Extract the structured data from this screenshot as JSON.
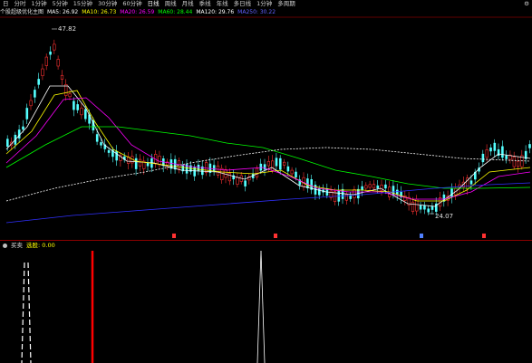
{
  "colors": {
    "bg": "#000000",
    "up_candle": "#ff3232",
    "down_candle": "#54ffff",
    "ma5": "#ffffff",
    "ma10": "#ffff00",
    "ma20": "#ff00ff",
    "ma60": "#00ff00",
    "ma120": "#ffffff",
    "ma250": "#3030ff",
    "signal_red": "#ff0000",
    "signal_white": "#ffffff"
  },
  "toolbar": {
    "items": [
      "日",
      "分时",
      "1分钟",
      "5分钟",
      "15分钟",
      "30分钟",
      "60分钟",
      "日线",
      "周线",
      "月线",
      "季线",
      "年线",
      "多日线",
      "1分钟",
      "多周期"
    ],
    "right_icon": "settings-icon"
  },
  "legend": {
    "title": "个股超级优化主图",
    "items": [
      {
        "label": "MA5: 26.92",
        "color": "#ffffff"
      },
      {
        "label": "MA10: 26.73",
        "color": "#ffff00"
      },
      {
        "label": "MA20: 26.59",
        "color": "#ff00ff"
      },
      {
        "label": "MA60: 28.44",
        "color": "#00ff00"
      },
      {
        "label": "MA120: 29.76",
        "color": "#ffffff"
      },
      {
        "label": "MA250: 30.22",
        "color": "#3030ff"
      }
    ]
  },
  "price_labels": {
    "high": "47.82",
    "low": "24.07"
  },
  "indicator": {
    "name": "买卖",
    "value_label": "选股: 0.00"
  }
}
